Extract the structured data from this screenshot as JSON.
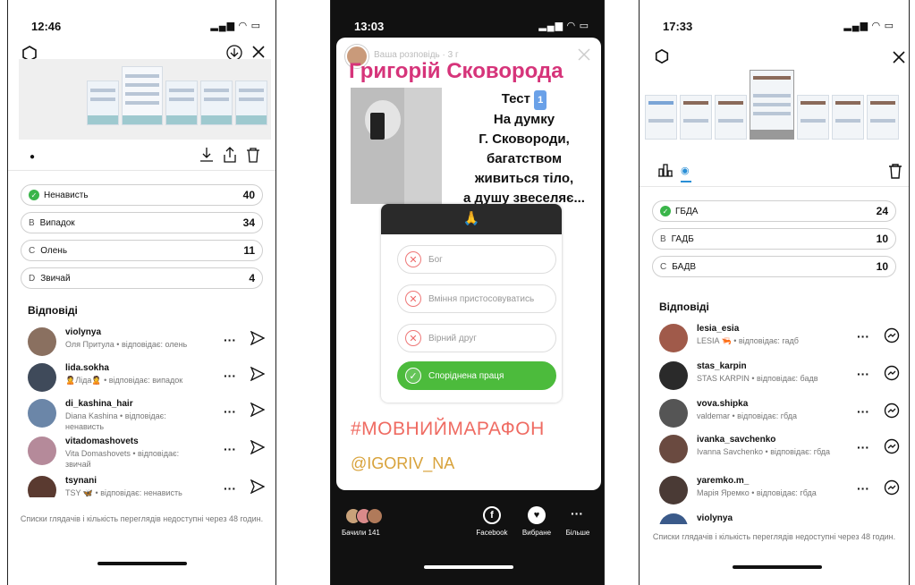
{
  "panel1": {
    "time": "12:46",
    "options": [
      {
        "letter": "",
        "label": "Ненависть",
        "count": "40",
        "correct": true
      },
      {
        "letter": "B",
        "label": "Випадок",
        "count": "34",
        "correct": false
      },
      {
        "letter": "C",
        "label": "Олень",
        "count": "11",
        "correct": false
      },
      {
        "letter": "D",
        "label": "Звичай",
        "count": "4",
        "correct": false
      }
    ],
    "answers_title": "Відповіді",
    "responses": [
      {
        "username": "violynya",
        "sub": "Оля Притула • відповідає: олень"
      },
      {
        "username": "lida.sokha",
        "sub": "🙎Ліда🙎 • відповідає: випадок"
      },
      {
        "username": "di_kashina_hair",
        "sub": "Diana Kashina • відповідає: ненависть"
      },
      {
        "username": "vitadomashovets",
        "sub": "Vita Domashovets • відповідає: звичай"
      },
      {
        "username": "tsynani",
        "sub": "TSY 🦋 • відповідає: ненависть"
      }
    ],
    "footer": "Списки глядачів і кількість переглядів недоступні через 48 годин."
  },
  "panel2": {
    "time": "13:03",
    "header": "Ваша розповідь · 3 г",
    "name": "Григорій Сковорода",
    "test_text": "Тест",
    "test_num": "1",
    "quote": [
      "На думку",
      "Г. Сковороди,",
      "багатством",
      "живиться тіло,",
      "а душу звеселяє..."
    ],
    "emoji": "🙏",
    "quiz": [
      "Бог",
      "Вміння пристосовуватись",
      "Вірний друг",
      "Споріднена праця"
    ],
    "hashtag": "#МОВНИЙМАРАФОН",
    "mention": "@IGORIV_NA",
    "viewers": "Бачили 141",
    "actions": [
      "Facebook",
      "Вибране",
      "Більше"
    ]
  },
  "panel3": {
    "time": "17:33",
    "options": [
      {
        "letter": "",
        "label": "ГБДА",
        "count": "24",
        "correct": true
      },
      {
        "letter": "B",
        "label": "ГАДБ",
        "count": "10",
        "correct": false
      },
      {
        "letter": "C",
        "label": "БАДВ",
        "count": "10",
        "correct": false
      }
    ],
    "answers_title": "Відповіді",
    "responses": [
      {
        "username": "lesia_esia",
        "sub": "LESIA 🦐 • відповідає: гадб"
      },
      {
        "username": "stas_karpin",
        "sub": "STAS KARPIN • відповідає: бадв"
      },
      {
        "username": "vova.shipka",
        "sub": "valdemar • відповідає: гбда"
      },
      {
        "username": "ivanka_savchenko",
        "sub": "Ivanna Savchenko • відповідає: гбда"
      },
      {
        "username": "yaremko.m_",
        "sub": "Марія Яремко • відповідає: гбда"
      },
      {
        "username": "violynya",
        "sub": ""
      }
    ],
    "footer": "Списки глядачів і кількість переглядів недоступні через 48 годин."
  }
}
